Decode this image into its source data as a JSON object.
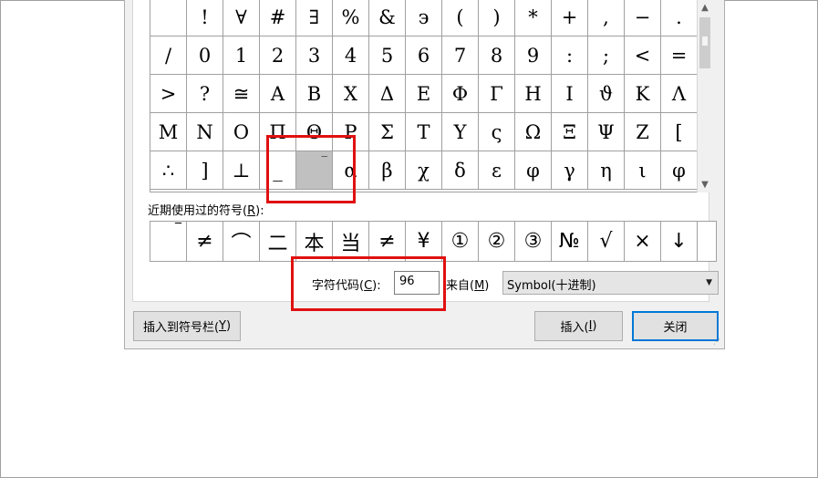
{
  "symbol_grid": {
    "rows": [
      [
        "",
        "!",
        "∀",
        "#",
        "∃",
        "%",
        "&",
        "϶",
        "(",
        ")",
        "*",
        "+",
        ",",
        "−",
        "."
      ],
      [
        "/",
        "0",
        "1",
        "2",
        "3",
        "4",
        "5",
        "6",
        "7",
        "8",
        "9",
        ":",
        ";",
        "<",
        "="
      ],
      [
        ">",
        "?",
        "≅",
        "Α",
        "Β",
        "Χ",
        "Δ",
        "Ε",
        "Φ",
        "Γ",
        "Η",
        "Ι",
        "ϑ",
        "Κ",
        "Λ"
      ],
      [
        "Μ",
        "Ν",
        "Ο",
        "Π",
        "Θ",
        "Ρ",
        "Σ",
        "Τ",
        "Υ",
        "ς",
        "Ω",
        "Ξ",
        "Ψ",
        "Ζ",
        "["
      ],
      [
        "∴",
        "]",
        "⊥",
        "_",
        "‾",
        "α",
        "β",
        "χ",
        "δ",
        "ε",
        "φ",
        "γ",
        "η",
        "ι",
        "φ"
      ]
    ],
    "selected": {
      "row": 4,
      "col": 4
    }
  },
  "recent": {
    "label": "近期使用过的符号(",
    "accel": "R",
    "label_end": "):",
    "symbols": [
      "‾",
      "≠",
      "⌒",
      "二",
      "本",
      "当",
      "≠",
      "¥",
      "①",
      "②",
      "③",
      "№",
      "√",
      "×",
      "↓"
    ]
  },
  "char_code": {
    "label": "字符代码(",
    "accel": "C",
    "label_end": "):",
    "value": "96"
  },
  "from": {
    "label": "来自(",
    "accel": "M",
    "label_end": ")",
    "selected": "Symbol(十进制)"
  },
  "buttons": {
    "insert_to_bar": {
      "text": "插入到符号栏(",
      "accel": "Y",
      "end": ")"
    },
    "insert": {
      "text": "插入(",
      "accel": "I",
      "end": ")"
    },
    "close": {
      "text": "关闭"
    }
  },
  "icons": {
    "scroll_up": "chevron-up-icon",
    "scroll_down": "chevron-down-icon",
    "dropdown": "chevron-down-icon",
    "resize_grip": "resize-grip-icon"
  },
  "colors": {
    "highlight": "#e01010",
    "selected_cell": "#c0c0c0",
    "default_button_border": "#0078d7"
  }
}
